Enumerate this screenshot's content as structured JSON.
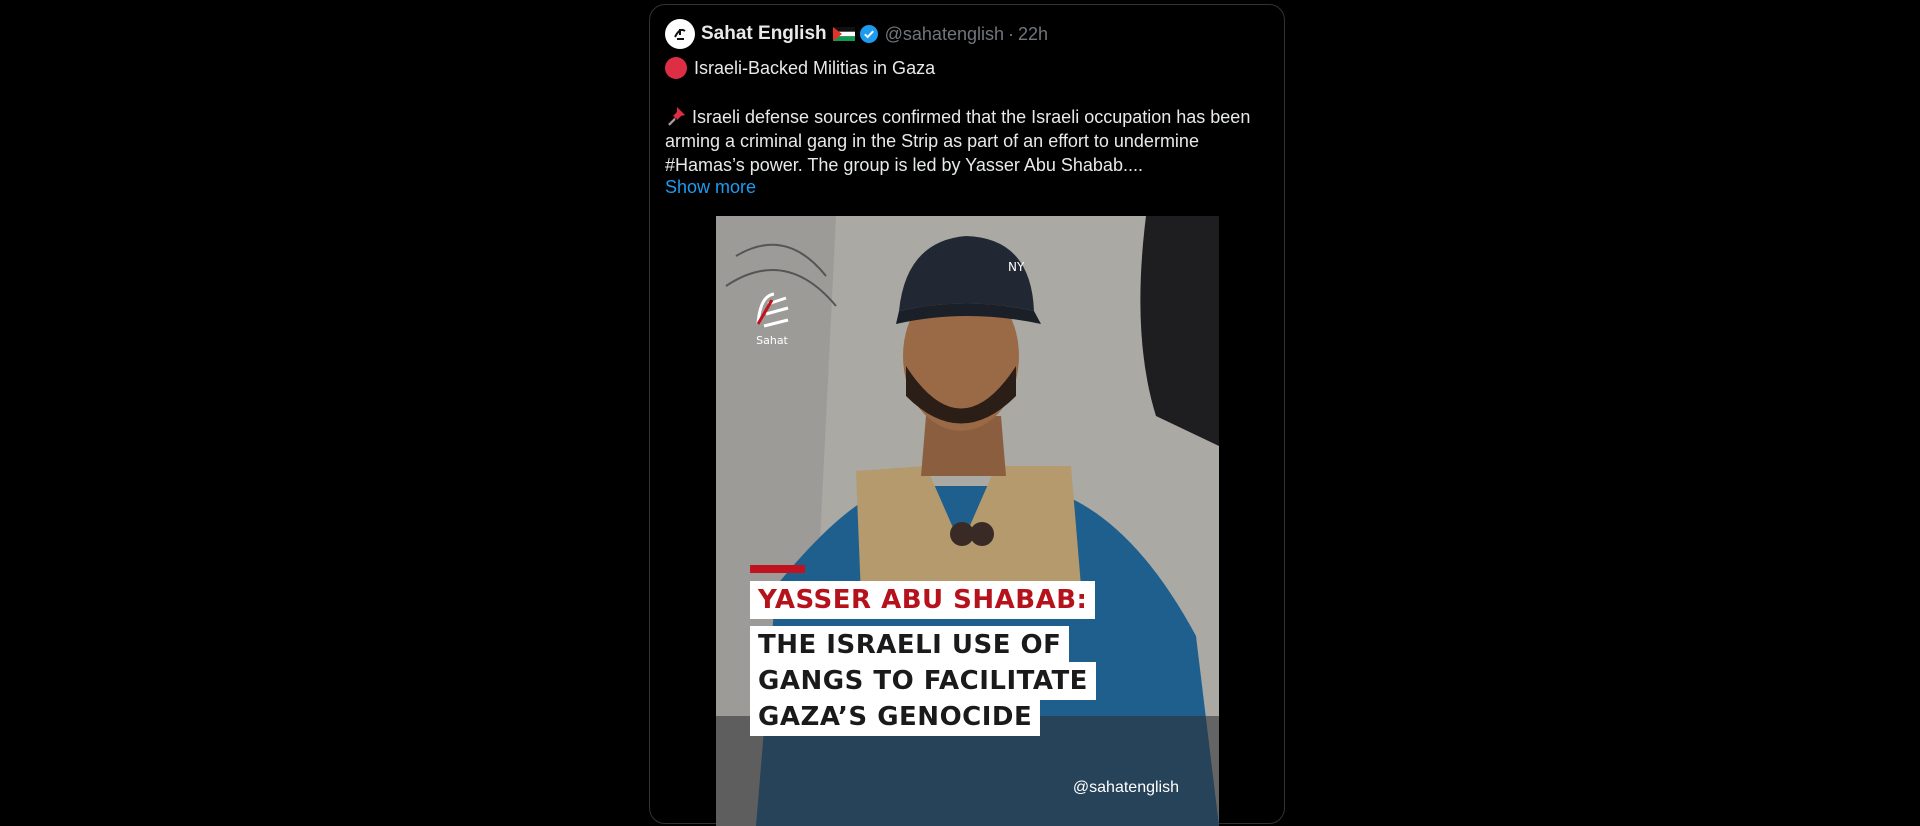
{
  "tweet": {
    "author": {
      "name": "Sahat English",
      "handle": "@sahatenglish",
      "separator": "·",
      "time": "22h",
      "verified": true,
      "flag": "palestine-flag",
      "avatar_icon": "sahat-logo-icon"
    },
    "headline": "Israeli-Backed Militias in Gaza",
    "body": "Israeli defense sources confirmed that the Israeli occupation has been arming a criminal gang in the Strip as part of an effort to undermine #Hamas’s power. The group is led by Yasser Abu Shabab....",
    "show_more": "Show more",
    "colors": {
      "link": "#1d9bf0",
      "muted": "#71767b",
      "text": "#e7e9ea",
      "accent_red": "#dd2e44"
    }
  },
  "media": {
    "logo_text": "Sahat",
    "caption_title": "YASSER ABU SHABAB:",
    "caption_lines": [
      "THE ISRAELI USE OF",
      "GANGS TO FACILITATE",
      "GAZA’S GENOCIDE"
    ],
    "watermark": "@sahatenglish",
    "colors": {
      "title_red": "#b5121b",
      "bar_red": "#c1121f"
    }
  }
}
